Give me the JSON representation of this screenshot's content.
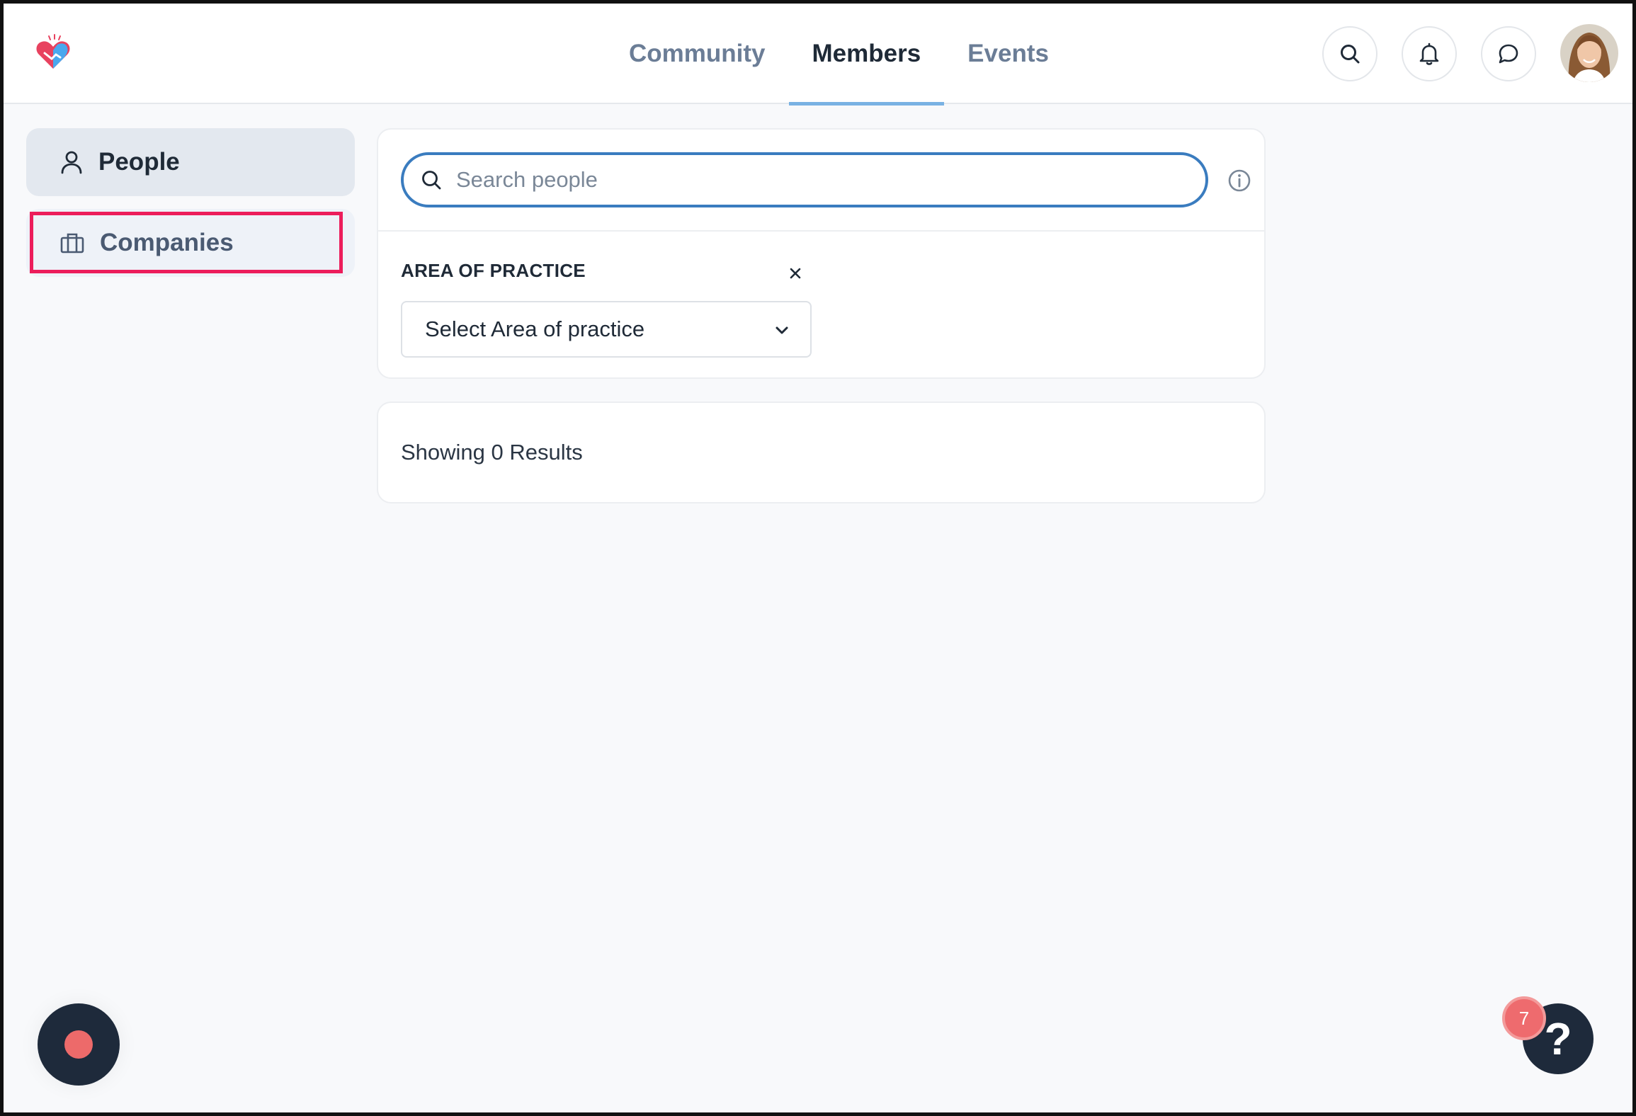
{
  "header": {
    "nav_tabs": [
      {
        "label": "Community",
        "active": false
      },
      {
        "label": "Members",
        "active": true
      },
      {
        "label": "Events",
        "active": false
      }
    ],
    "icons": [
      "search-icon",
      "bell-icon",
      "chat-icon"
    ]
  },
  "sidebar": {
    "items": [
      {
        "label": "People",
        "icon": "person-icon",
        "active": true
      },
      {
        "label": "Companies",
        "icon": "briefcase-icon",
        "active": false,
        "highlighted": true
      }
    ]
  },
  "search": {
    "placeholder": "Search people",
    "value": ""
  },
  "filter": {
    "label": "AREA OF PRACTICE",
    "select_placeholder": "Select Area of practice"
  },
  "results": {
    "text": "Showing 0 Results"
  },
  "help": {
    "badge_count": "7",
    "label": "?"
  },
  "colors": {
    "accent": "#3a7cbf",
    "tab_underline": "#7ab2e3",
    "highlight": "#ec1d5b",
    "dark_button": "#1e2a3b",
    "record_dot": "#ed6a6a"
  }
}
